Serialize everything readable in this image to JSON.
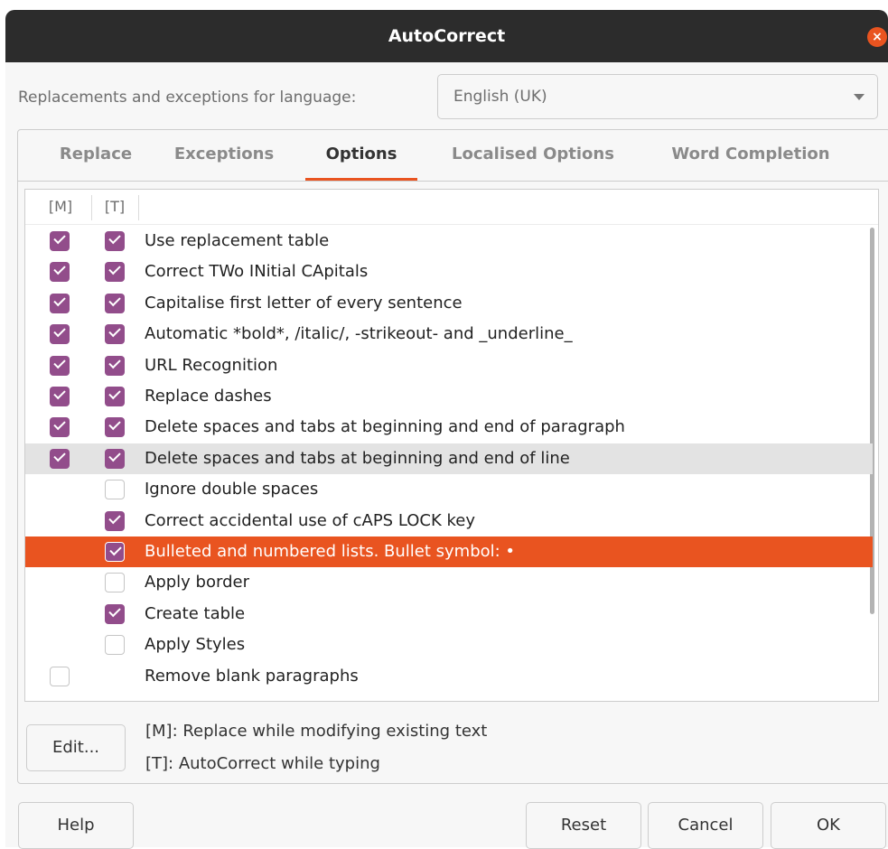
{
  "window": {
    "title": "AutoCorrect",
    "close_icon": "×"
  },
  "language": {
    "label": "Replacements and exceptions for language:",
    "value": "English (UK)"
  },
  "tabs": [
    {
      "label": "Replace",
      "active": false
    },
    {
      "label": "Exceptions",
      "active": false
    },
    {
      "label": "Options",
      "active": true
    },
    {
      "label": "Localised Options",
      "active": false
    },
    {
      "label": "Word Completion",
      "active": false
    }
  ],
  "options": {
    "col_m": "[M]",
    "col_t": "[T]",
    "rows": [
      {
        "label": "Use replacement table",
        "m": true,
        "t": true
      },
      {
        "label": "Correct TWo INitial CApitals",
        "m": true,
        "t": true
      },
      {
        "label": "Capitalise first letter of every sentence",
        "m": true,
        "t": true
      },
      {
        "label": "Automatic *bold*, /italic/, -strikeout- and _underline_",
        "m": true,
        "t": true
      },
      {
        "label": "URL Recognition",
        "m": true,
        "t": true
      },
      {
        "label": "Replace dashes",
        "m": true,
        "t": true
      },
      {
        "label": "Delete spaces and tabs at beginning and end of paragraph",
        "m": true,
        "t": true
      },
      {
        "label": "Delete spaces and tabs at beginning and end of line",
        "m": true,
        "t": true,
        "hover": true
      },
      {
        "label": "Ignore double spaces",
        "t": false
      },
      {
        "label": "Correct accidental use of cAPS LOCK key",
        "t": true
      },
      {
        "label": "Bulleted and numbered lists. Bullet symbol: •",
        "t": true,
        "selected": true
      },
      {
        "label": "Apply border",
        "t": false
      },
      {
        "label": "Create table",
        "t": true
      },
      {
        "label": "Apply Styles",
        "t": false
      },
      {
        "label": "Remove blank paragraphs",
        "m": false
      }
    ]
  },
  "edit_button": "Edit...",
  "legend": {
    "m": "[M]: Replace while modifying existing text",
    "t": "[T]: AutoCorrect while typing"
  },
  "buttons": {
    "help": "Help",
    "reset": "Reset",
    "cancel": "Cancel",
    "ok": "OK"
  },
  "colors": {
    "accent": "#e95420",
    "checkbox": "#924d8b",
    "titlebar": "#2c2c2c"
  }
}
